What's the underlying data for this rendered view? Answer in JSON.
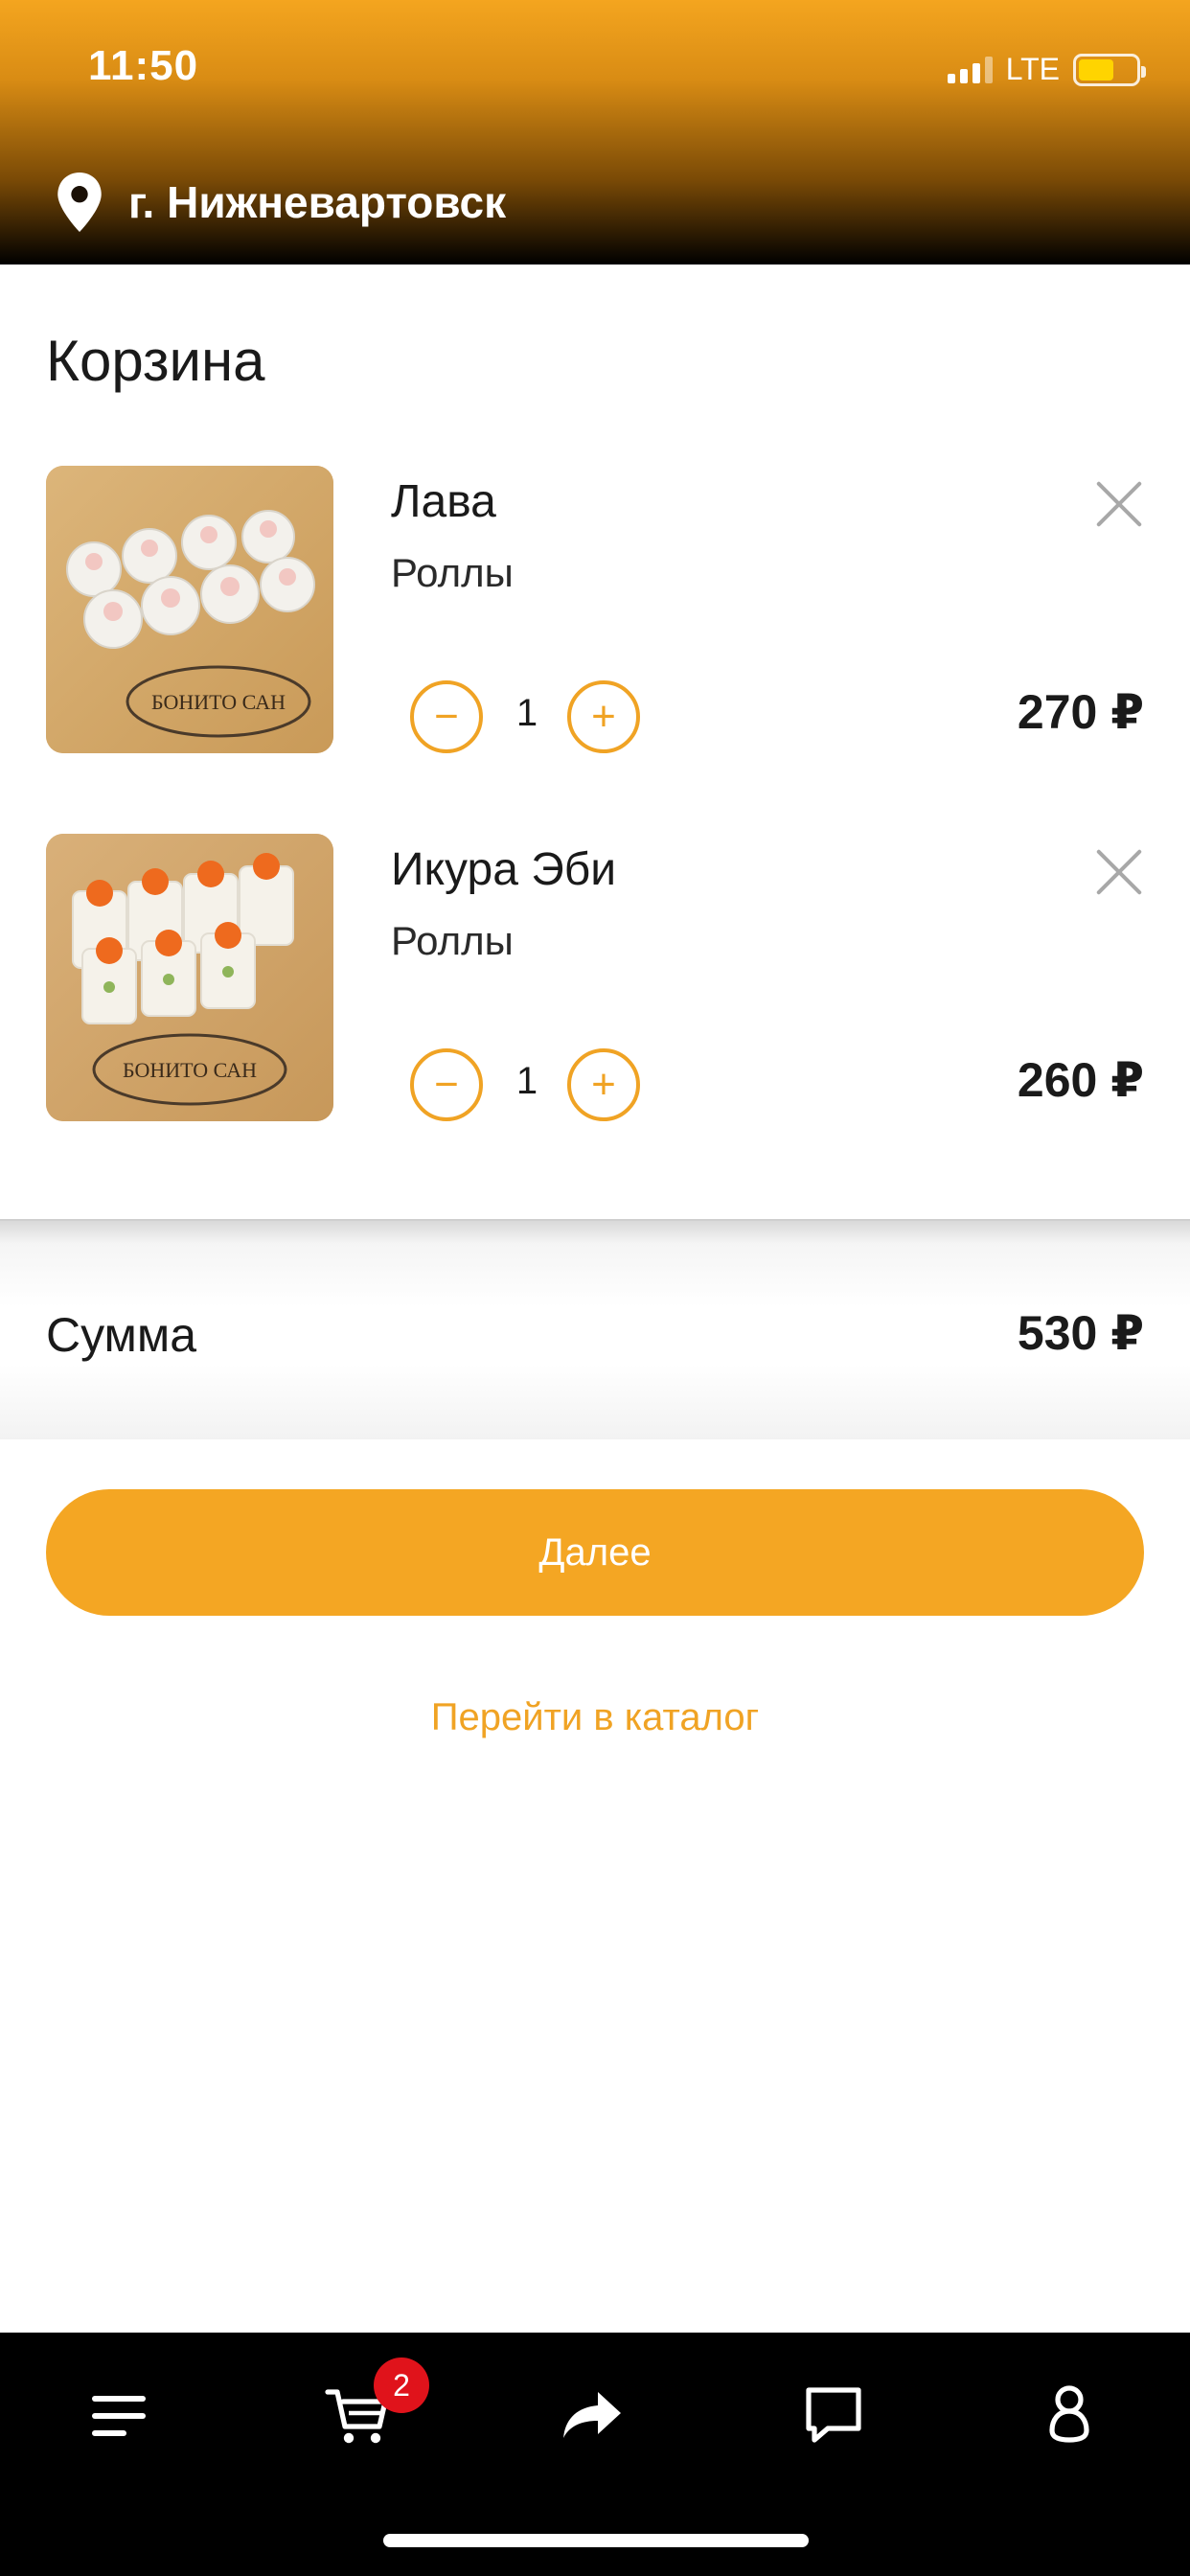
{
  "status_bar": {
    "time": "11:50",
    "network": "LTE"
  },
  "header": {
    "location": "г. Нижневартовск"
  },
  "cart": {
    "title": "Корзина",
    "items": [
      {
        "name": "Лава",
        "category": "Роллы",
        "quantity": "1",
        "price": "270 ₽",
        "logo_text": "БОНИТО САН"
      },
      {
        "name": "Икура Эби",
        "category": "Роллы",
        "quantity": "1",
        "price": "260 ₽",
        "logo_text": "БОНИТО САН"
      }
    ]
  },
  "summary": {
    "label": "Сумма",
    "total": "530 ₽"
  },
  "actions": {
    "next": "Далее",
    "catalog": "Перейти в каталог"
  },
  "bottom_nav": {
    "cart_badge": "2",
    "icons": [
      "menu-icon",
      "cart-icon",
      "share-icon",
      "chat-icon",
      "profile-icon"
    ]
  },
  "colors": {
    "accent": "#f4a623",
    "badge": "#e0131b",
    "nav_bg": "#000000"
  }
}
